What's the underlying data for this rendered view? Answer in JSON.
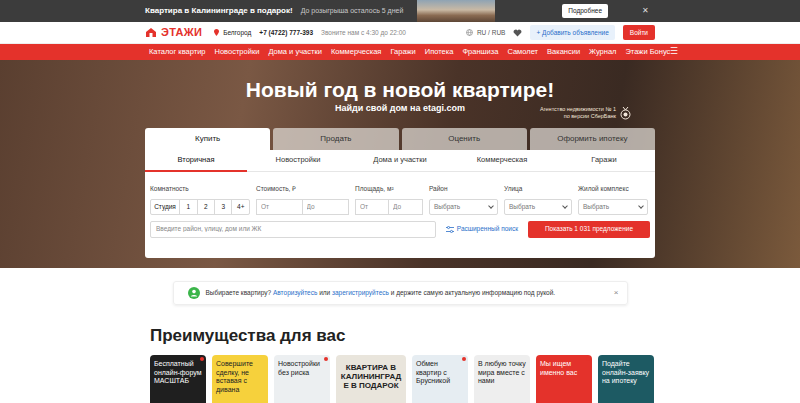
{
  "promo": {
    "title": "Квартира в Калининграде в подарок!",
    "countdown": "До розыгрыша осталось 5 дней",
    "button": "Подробнее",
    "close": "✕"
  },
  "header": {
    "logo": "ЭТАЖИ",
    "city": "Белгород",
    "phone": "+7 (4722) 777-393",
    "hours": "Звоните нам с 4:30 до 22:00",
    "locale": "RU / RUB",
    "add": "+ Добавить объявление",
    "login": "Войти"
  },
  "nav": {
    "items": [
      "Каталог квартир",
      "Новостройки",
      "Дома и участки",
      "Коммерческая",
      "Гаражи",
      "Ипотека",
      "Франшиза",
      "Самолет",
      "Вакансии",
      "Журнал",
      "Этажи Бонус"
    ],
    "menu": "☰"
  },
  "hero": {
    "title": "Новый год в новой квартире!",
    "subtitle": "Найди свой дом на etagi.com",
    "award": "Агентство недвижимости № 1",
    "award_note": "по версии СберБанк"
  },
  "deal_tabs": [
    {
      "label": "Купить",
      "selected": true
    },
    {
      "label": "Продать",
      "selected": false
    },
    {
      "label": "Оценить",
      "selected": false
    },
    {
      "label": "Оформить ипотеку",
      "selected": false
    }
  ],
  "type_tabs": [
    {
      "label": "Вторичная",
      "selected": true
    },
    {
      "label": "Новостройки",
      "selected": false
    },
    {
      "label": "Дома и участки",
      "selected": false
    },
    {
      "label": "Коммерческая",
      "selected": false
    },
    {
      "label": "Гаражи",
      "selected": false
    }
  ],
  "filters": {
    "rooms": {
      "label": "Комнатность",
      "options": [
        {
          "label": "Студия",
          "selected": false
        },
        {
          "label": "1",
          "selected": false
        },
        {
          "label": "2",
          "selected": false
        },
        {
          "label": "3",
          "selected": false
        },
        {
          "label": "4+",
          "selected": false
        }
      ]
    },
    "price": {
      "label": "Стоимость, ₽",
      "from": "От",
      "to": "До"
    },
    "area": {
      "label": "Площадь, м²",
      "from": "От",
      "to": "До"
    },
    "district": {
      "label": "Район",
      "value": "Выбрать"
    },
    "street": {
      "label": "Улица",
      "value": "Выбрать"
    },
    "complex": {
      "label": "Жилой комплекс",
      "value": "Выбрать"
    }
  },
  "search": {
    "placeholder": "Введите район, улицу, дом или ЖК",
    "advanced": "Расширенный поиск",
    "submit": "Показать 1 031 предложение"
  },
  "notice": {
    "prefix": "Выбираете квартиру?",
    "login": "Авторизуйтесь",
    "or": "или",
    "register": "зарегистрируйтесь",
    "suffix": "и держите самую актуальную информацию под рукой.",
    "close": "×"
  },
  "advantages": {
    "title": "Преимущества для вас",
    "cards": [
      {
        "text": "Бесплатный онлайн-форум МАСШТАБ",
        "color": "#1f1f1f",
        "new": true,
        "kind": "text"
      },
      {
        "text": "Совершите сделку, не вставая с дивана",
        "color": "#f6d13c",
        "new": false,
        "kind": "text"
      },
      {
        "text": "Новостройки без риска",
        "color": "#eceff1",
        "new": true,
        "kind": "text"
      },
      {
        "text": "КВАРТИРА В КАЛИНИНГРАДЕ В ПОДАРОК",
        "color": "#e9e5dc",
        "new": false,
        "kind": "promo"
      },
      {
        "text": "Обмен квартир с Брусникой",
        "color": "#e6edf2",
        "new": true,
        "kind": "text"
      },
      {
        "text": "В любую точку мира вместе с нами",
        "color": "#eeeeee",
        "new": false,
        "kind": "text"
      },
      {
        "text": "Мы ищем именно вас",
        "color": "#e4322b",
        "new": true,
        "kind": "text"
      },
      {
        "text": "Подайте онлайн-заявку на ипотеку",
        "color": "#1d5a63",
        "new": false,
        "kind": "text"
      }
    ]
  }
}
